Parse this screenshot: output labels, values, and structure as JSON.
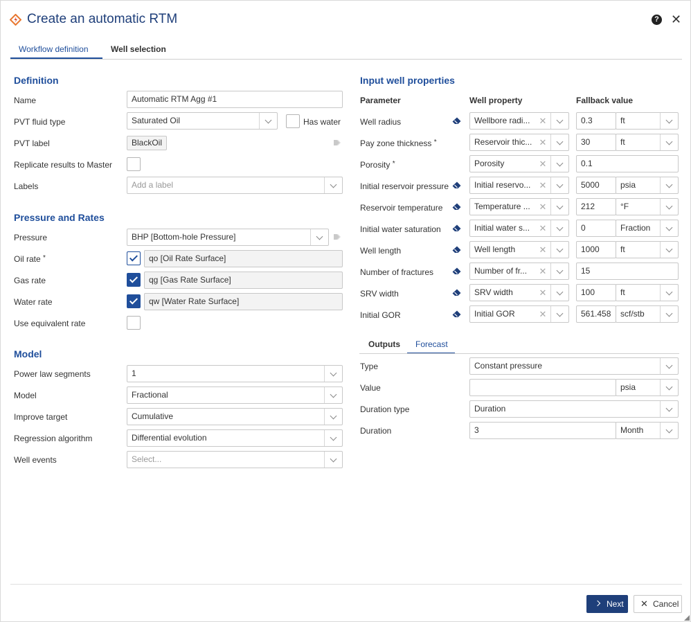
{
  "header": {
    "title": "Create an automatic RTM",
    "help_glyph": "?",
    "close_glyph": "✕"
  },
  "tabs": [
    {
      "label": "Workflow definition",
      "active": true
    },
    {
      "label": "Well selection",
      "active": false
    }
  ],
  "definition": {
    "title": "Definition",
    "name": {
      "label": "Name",
      "value": "Automatic RTM Agg #1"
    },
    "pvt_fluid_type": {
      "label": "PVT fluid type",
      "value": "Saturated Oil",
      "has_water_label": "Has water",
      "has_water_checked": false
    },
    "pvt_label": {
      "label": "PVT label",
      "tag": "BlackOil"
    },
    "replicate": {
      "label": "Replicate results to Master",
      "checked": false
    },
    "labels": {
      "label": "Labels",
      "placeholder": "Add a label"
    }
  },
  "pressure_rates": {
    "title": "Pressure and Rates",
    "pressure": {
      "label": "Pressure",
      "value": "BHP [Bottom-hole Pressure]"
    },
    "oil_rate": {
      "label": "Oil rate",
      "req": "*",
      "value": "qo [Oil Rate Surface]",
      "checked": true
    },
    "gas_rate": {
      "label": "Gas rate",
      "value": "qg [Gas Rate Surface]",
      "checked": true
    },
    "water_rate": {
      "label": "Water rate",
      "value": "qw [Water Rate Surface]",
      "checked": true
    },
    "equivalent": {
      "label": "Use equivalent rate",
      "checked": false
    }
  },
  "model": {
    "title": "Model",
    "power_law": {
      "label": "Power law segments",
      "value": "1"
    },
    "model": {
      "label": "Model",
      "value": "Fractional"
    },
    "improve_target": {
      "label": "Improve target",
      "value": "Cumulative"
    },
    "regression": {
      "label": "Regression algorithm",
      "value": "Differential evolution"
    },
    "well_events": {
      "label": "Well events",
      "placeholder": "Select..."
    }
  },
  "input_well": {
    "title": "Input well properties",
    "col_parameter": "Parameter",
    "col_well_property": "Well property",
    "col_fallback": "Fallback value",
    "rows": [
      {
        "param": "Well radius",
        "req": "",
        "eraser": true,
        "property": "Wellbore radi...",
        "value": "0.3",
        "unit": "ft"
      },
      {
        "param": "Pay zone thickness",
        "req": "*",
        "eraser": false,
        "property": "Reservoir thic...",
        "value": "30",
        "unit": "ft"
      },
      {
        "param": "Porosity",
        "req": "*",
        "eraser": false,
        "property": "Porosity",
        "value": "0.1",
        "unit": ""
      },
      {
        "param": "Initial reservoir pressure",
        "req": "",
        "eraser": true,
        "property": "Initial reservo...",
        "value": "5000",
        "unit": "psia"
      },
      {
        "param": "Reservoir temperature",
        "req": "",
        "eraser": true,
        "property": "Temperature ...",
        "value": "212",
        "unit": "°F"
      },
      {
        "param": "Initial water saturation",
        "req": "",
        "eraser": true,
        "property": "Initial water s...",
        "value": "0",
        "unit": "Fraction"
      },
      {
        "param": "Well length",
        "req": "",
        "eraser": true,
        "property": "Well length",
        "value": "1000",
        "unit": "ft"
      },
      {
        "param": "Number of fractures",
        "req": "",
        "eraser": true,
        "property": "Number of fr...",
        "value": "15",
        "unit": ""
      },
      {
        "param": "SRV width",
        "req": "",
        "eraser": true,
        "property": "SRV width",
        "value": "100",
        "unit": "ft"
      },
      {
        "param": "Initial GOR",
        "req": "",
        "eraser": true,
        "property": "Initial GOR",
        "value": "561.458",
        "unit": "scf/stb"
      }
    ]
  },
  "subtabs": [
    {
      "label": "Outputs",
      "active": false
    },
    {
      "label": "Forecast",
      "active": true
    }
  ],
  "forecast": {
    "type": {
      "label": "Type",
      "value": "Constant pressure"
    },
    "value": {
      "label": "Value",
      "value": "",
      "unit": "psia"
    },
    "duration_type": {
      "label": "Duration type",
      "value": "Duration"
    },
    "duration": {
      "label": "Duration",
      "value": "3",
      "unit": "Month"
    }
  },
  "footer": {
    "next_label": "Next",
    "cancel_label": "Cancel"
  },
  "colors": {
    "brand": "#1f4e9b",
    "title": "#1f3f7a",
    "logo_orange": "#e8772e",
    "logo_red": "#d8432b"
  }
}
